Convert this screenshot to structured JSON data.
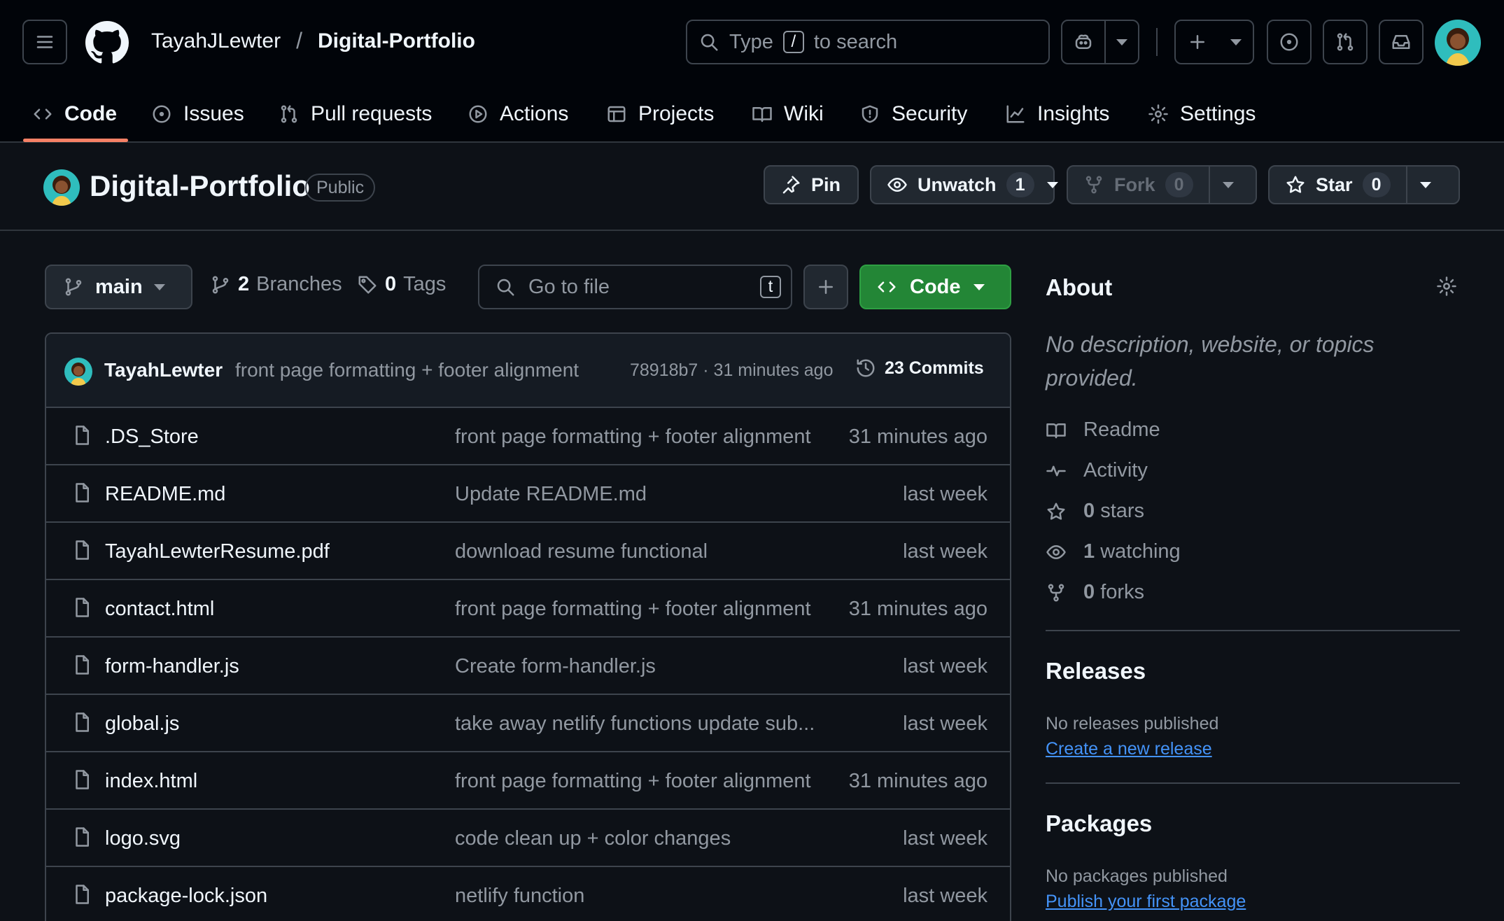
{
  "header": {
    "owner": "TayahJLewter",
    "separator": "/",
    "repo": "Digital-Portfolio",
    "search": {
      "prefix": "Type",
      "key": "/",
      "suffix": "to search"
    }
  },
  "tabs": [
    {
      "label": "Code",
      "icon": "code-icon"
    },
    {
      "label": "Issues",
      "icon": "issue-icon"
    },
    {
      "label": "Pull requests",
      "icon": "pull-request-icon"
    },
    {
      "label": "Actions",
      "icon": "play-icon"
    },
    {
      "label": "Projects",
      "icon": "table-icon"
    },
    {
      "label": "Wiki",
      "icon": "book-icon"
    },
    {
      "label": "Security",
      "icon": "shield-icon"
    },
    {
      "label": "Insights",
      "icon": "graph-icon"
    },
    {
      "label": "Settings",
      "icon": "gear-icon"
    }
  ],
  "repo_bar": {
    "title": "Digital-Portfolio",
    "visibility": "Public",
    "pin": "Pin",
    "unwatch": "Unwatch",
    "watch_count": "1",
    "fork": "Fork",
    "fork_count": "0",
    "star": "Star",
    "star_count": "0"
  },
  "toolbar": {
    "branch": "main",
    "branches_count": "2",
    "branches_label": "Branches",
    "tags_count": "0",
    "tags_label": "Tags",
    "goto_placeholder": "Go to file",
    "goto_key": "t",
    "code_button": "Code"
  },
  "commit": {
    "author": "TayahLewter",
    "message": "front page formatting + footer alignment",
    "meta": "78918b7 · 31 minutes ago",
    "commits_label": "23 Commits"
  },
  "files": [
    {
      "name": ".DS_Store",
      "message": "front page formatting + footer alignment",
      "date": "31 minutes ago"
    },
    {
      "name": "README.md",
      "message": "Update README.md",
      "date": "last week"
    },
    {
      "name": "TayahLewterResume.pdf",
      "message": "download resume functional",
      "date": "last week"
    },
    {
      "name": "contact.html",
      "message": "front page formatting + footer alignment",
      "date": "31 minutes ago"
    },
    {
      "name": "form-handler.js",
      "message": "Create form-handler.js",
      "date": "last week"
    },
    {
      "name": "global.js",
      "message": "take away netlify functions update sub...",
      "date": "last week"
    },
    {
      "name": "index.html",
      "message": "front page formatting + footer alignment",
      "date": "31 minutes ago"
    },
    {
      "name": "logo.svg",
      "message": "code clean up + color changes",
      "date": "last week"
    },
    {
      "name": "package-lock.json",
      "message": "netlify function",
      "date": "last week"
    }
  ],
  "about": {
    "title": "About",
    "description": "No description, website, or topics provided.",
    "items": [
      {
        "label": "Readme",
        "icon": "book-icon"
      },
      {
        "label": "Activity",
        "icon": "pulse-icon"
      },
      {
        "count": "0",
        "label": "stars",
        "icon": "star-icon"
      },
      {
        "count": "1",
        "label": "watching",
        "icon": "eye-icon"
      },
      {
        "count": "0",
        "label": "forks",
        "icon": "fork-icon"
      }
    ]
  },
  "releases": {
    "title": "Releases",
    "note": "No releases published",
    "link": "Create a new release"
  },
  "packages": {
    "title": "Packages",
    "note": "No packages published",
    "link": "Publish your first package"
  },
  "colors": {
    "background": "#0d1117",
    "header": "#010409",
    "accent_tab": "#f78166",
    "code_button": "#238636",
    "link": "#4493f8",
    "avatar": "#2fbdbd"
  }
}
